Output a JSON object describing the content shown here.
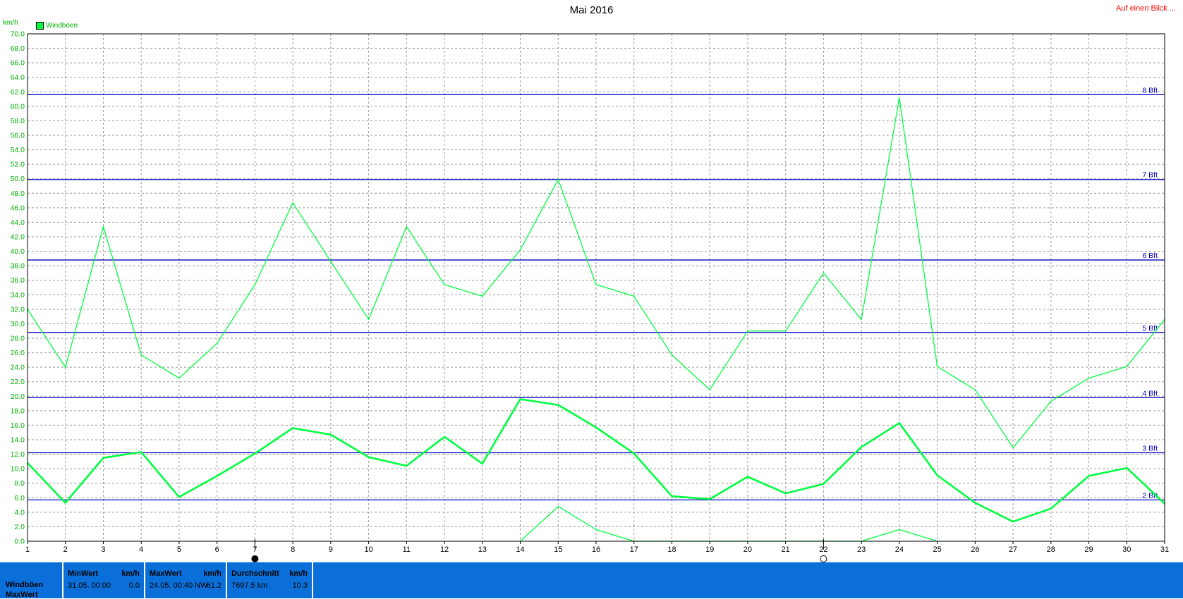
{
  "header": {
    "title": "Mai 2016",
    "link": "Auf einen Blick ...",
    "unit": "km/h",
    "legend": "Windböen",
    "colors": {
      "series": "#00ff40",
      "bft": "#0000c0",
      "panel": "#0a6fd8",
      "link": "#ff0000"
    }
  },
  "chart_data": {
    "type": "line",
    "title": "Mai 2016",
    "ylabel": "km/h",
    "xlim": [
      1,
      31
    ],
    "ylim": [
      0,
      70
    ],
    "y_ticks": [
      "0.0",
      "2.0",
      "4.0",
      "6.0",
      "8.0",
      "10.0",
      "12.0",
      "14.0",
      "16.0",
      "18.0",
      "20.0",
      "22.0",
      "24.0",
      "26.0",
      "28.0",
      "30.0",
      "32.0",
      "34.0",
      "36.0",
      "38.0",
      "40.0",
      "42.0",
      "44.0",
      "46.0",
      "48.0",
      "50.0",
      "52.0",
      "54.0",
      "56.0",
      "58.0",
      "60.0",
      "62.0",
      "64.0",
      "66.0",
      "68.0",
      "70.0"
    ],
    "x_ticks": [
      "1",
      "2",
      "3",
      "4",
      "5",
      "6",
      "7",
      "8",
      "9",
      "10",
      "11",
      "12",
      "13",
      "14",
      "15",
      "16",
      "17",
      "18",
      "19",
      "20",
      "21",
      "22",
      "23",
      "24",
      "25",
      "26",
      "27",
      "28",
      "29",
      "30",
      "31"
    ],
    "grid": true,
    "legend": "top-left",
    "series": [
      {
        "name": "Windböen",
        "style": "max",
        "x": [
          1,
          2,
          3,
          4,
          5,
          6,
          7,
          8,
          9,
          10,
          11,
          12,
          13,
          14,
          15,
          16,
          17,
          18,
          19,
          20,
          21,
          22,
          23,
          24,
          25,
          26,
          27,
          28,
          29,
          30,
          31
        ],
        "values": [
          32.0,
          24.0,
          43.4,
          25.7,
          22.5,
          27.3,
          35.4,
          46.7,
          38.6,
          30.6,
          43.4,
          35.4,
          33.8,
          40.2,
          49.9,
          35.4,
          33.8,
          25.7,
          20.9,
          29.0,
          29.0,
          37.0,
          30.6,
          61.2,
          24.1,
          20.9,
          12.9,
          19.3,
          22.5,
          24.1,
          30.6
        ]
      },
      {
        "style": "mean",
        "x": [
          1,
          2,
          3,
          4,
          5,
          6,
          7,
          8,
          9,
          10,
          11,
          12,
          13,
          14,
          15,
          16,
          17,
          18,
          19,
          20,
          21,
          22,
          23,
          24,
          25,
          26,
          27,
          28,
          29,
          30,
          31
        ],
        "values": [
          10.8,
          5.3,
          11.5,
          12.3,
          6.1,
          9.0,
          12.1,
          15.6,
          14.7,
          11.6,
          10.4,
          14.4,
          10.7,
          19.6,
          18.8,
          15.7,
          12.1,
          6.2,
          5.8,
          8.9,
          6.6,
          7.9,
          13.0,
          16.3,
          9.1,
          5.3,
          2.7,
          4.5,
          9.0,
          10.1,
          5.2
        ]
      },
      {
        "style": "min",
        "x": [
          14,
          15,
          16,
          17,
          23,
          24,
          25
        ],
        "values": [
          0.0,
          4.8,
          1.6,
          0.0,
          0.0,
          1.6,
          0.0
        ]
      }
    ],
    "reference_lines": [
      {
        "label": "2 Bft",
        "value": 5.7
      },
      {
        "label": "3 Bft",
        "value": 12.2
      },
      {
        "label": "4 Bft",
        "value": 19.8
      },
      {
        "label": "5 Bft",
        "value": 28.8
      },
      {
        "label": "6 Bft",
        "value": 38.8
      },
      {
        "label": "7 Bft",
        "value": 49.9
      },
      {
        "label": "8 Bft",
        "value": 61.6
      }
    ],
    "moon_markers": [
      {
        "day": 7,
        "phase": "new"
      },
      {
        "day": 22,
        "phase": "full"
      }
    ]
  },
  "panel": {
    "row_labels": [
      "Windböen",
      "MaxWert"
    ],
    "min": {
      "label": "MinWert",
      "unit": "km/h",
      "date": "31.05.  00:00",
      "value": "0.0"
    },
    "max": {
      "label": "MaxWert",
      "unit": "km/h",
      "date": "24.05.  00:40",
      "dir": "NW",
      "value": "61.2"
    },
    "avg": {
      "label": "Durchschnitt",
      "unit": "km/h",
      "dist": "7697.5 km",
      "value": "10.3"
    }
  }
}
